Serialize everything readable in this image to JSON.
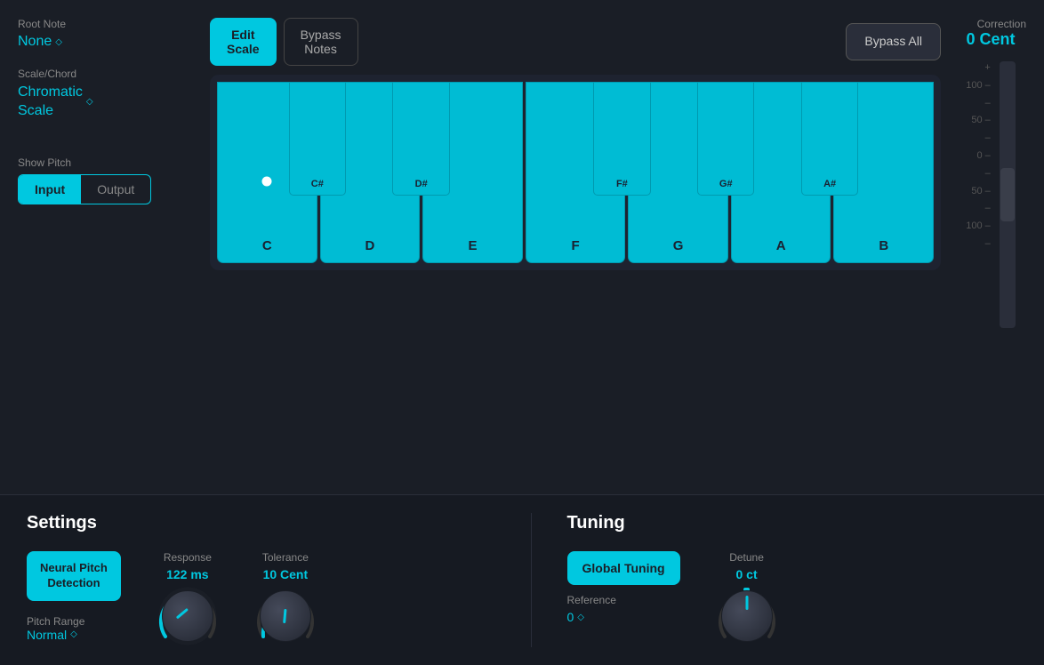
{
  "header": {
    "root_note_label": "Root Note",
    "root_note_value": "None",
    "scale_chord_label": "Scale/Chord",
    "scale_chord_value": "Chromatic\nScale",
    "show_pitch_label": "Show Pitch",
    "input_btn": "Input",
    "output_btn": "Output"
  },
  "toolbar": {
    "edit_scale_label": "Edit\nScale",
    "bypass_notes_label": "Bypass\nNotes",
    "bypass_all_label": "Bypass\nAll"
  },
  "piano": {
    "white_keys": [
      "C",
      "D",
      "E",
      "F",
      "G",
      "A",
      "B"
    ],
    "black_keys": [
      "C#",
      "D#",
      "F#",
      "G#",
      "A#"
    ],
    "dot_key": "C"
  },
  "correction": {
    "label": "Correction",
    "value": "0 Cent",
    "scale_labels": [
      "+",
      "100 -",
      "-",
      "50 -",
      "-",
      "0 -",
      "-",
      "50 -",
      "-",
      "100 -",
      "-"
    ]
  },
  "settings": {
    "title": "Settings",
    "neural_btn": "Neural Pitch\nDetection",
    "pitch_range_label": "Pitch Range",
    "pitch_range_value": "Normal",
    "response_label": "Response",
    "response_value": "122 ms",
    "tolerance_label": "Tolerance",
    "tolerance_value": "10 Cent"
  },
  "tuning": {
    "title": "Tuning",
    "global_tuning_btn": "Global Tuning",
    "reference_label": "Reference",
    "reference_value": "0",
    "detune_label": "Detune",
    "detune_value": "0 ct"
  }
}
